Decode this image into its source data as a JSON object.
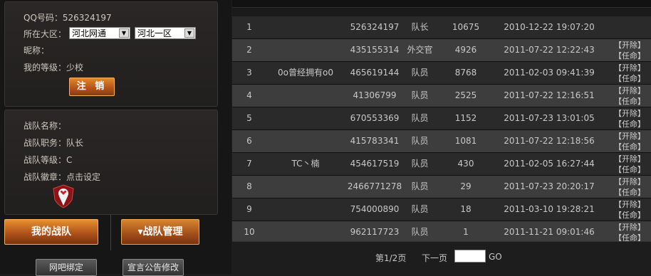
{
  "user": {
    "qq_label": "QQ号码：526324197",
    "region_label": "所在大区：",
    "region_select": "河北网通",
    "server_select": "河北一区",
    "nickname_label": "昵称：",
    "level_label": "我的等级：少校",
    "logout_label": "注 销"
  },
  "team": {
    "name_label": "战队名称：",
    "role_label": "战队职务：队长",
    "level_label": "战队等级：C",
    "badge_label": "战队徽章：",
    "badge_link": "点击设定"
  },
  "tabs": {
    "my_team": "我的战队",
    "team_manage": "▾战队管理"
  },
  "buttons": {
    "netbar_bind": "网吧绑定",
    "announce_edit": "宣言公告修改"
  },
  "members": [
    {
      "rank": "1",
      "name": "",
      "qq": "526324197",
      "role": "队长",
      "points": "10675",
      "time": "2010-12-22 19:07:20",
      "actions": []
    },
    {
      "rank": "2",
      "name": "",
      "qq": "435155314",
      "role": "外交官",
      "points": "4926",
      "time": "2011-07-22 12:22:43",
      "actions": [
        "【开除】",
        "【任命】"
      ]
    },
    {
      "rank": "3",
      "name": "0o曾经拥有o0",
      "qq": "465619144",
      "role": "队员",
      "points": "8768",
      "time": "2011-02-03 09:41:39",
      "actions": [
        "【开除】",
        "【任命】"
      ]
    },
    {
      "rank": "4",
      "name": "",
      "qq": "41306799",
      "role": "队员",
      "points": "2525",
      "time": "2011-07-22 12:16:51",
      "actions": [
        "【开除】",
        "【任命】"
      ]
    },
    {
      "rank": "5",
      "name": "",
      "qq": "670553369",
      "role": "队员",
      "points": "1152",
      "time": "2011-07-23 13:01:05",
      "actions": [
        "【开除】",
        "【任命】"
      ]
    },
    {
      "rank": "6",
      "name": "",
      "qq": "415783341",
      "role": "队员",
      "points": "1081",
      "time": "2011-07-22 12:18:56",
      "actions": [
        "【开除】",
        "【任命】"
      ]
    },
    {
      "rank": "7",
      "name": "TC丶楠",
      "qq": "454617519",
      "role": "队员",
      "points": "430",
      "time": "2011-02-05 16:27:44",
      "actions": [
        "【开除】",
        "【任命】"
      ]
    },
    {
      "rank": "8",
      "name": "",
      "qq": "2466771278",
      "role": "队员",
      "points": "29",
      "time": "2011-07-23 20:20:17",
      "actions": [
        "【开除】",
        "【任命】"
      ]
    },
    {
      "rank": "9",
      "name": "",
      "qq": "754000890",
      "role": "队员",
      "points": "18",
      "time": "2011-03-10 19:28:21",
      "actions": [
        "【开除】",
        "【任命】"
      ]
    },
    {
      "rank": "10",
      "name": "",
      "qq": "962117723",
      "role": "队员",
      "points": "1",
      "time": "2011-11-21 09:01:46",
      "actions": [
        "【开除】",
        "【任命】"
      ]
    }
  ],
  "pager": {
    "page_info": "第1/2页",
    "next": "下一页",
    "go": "GO"
  }
}
